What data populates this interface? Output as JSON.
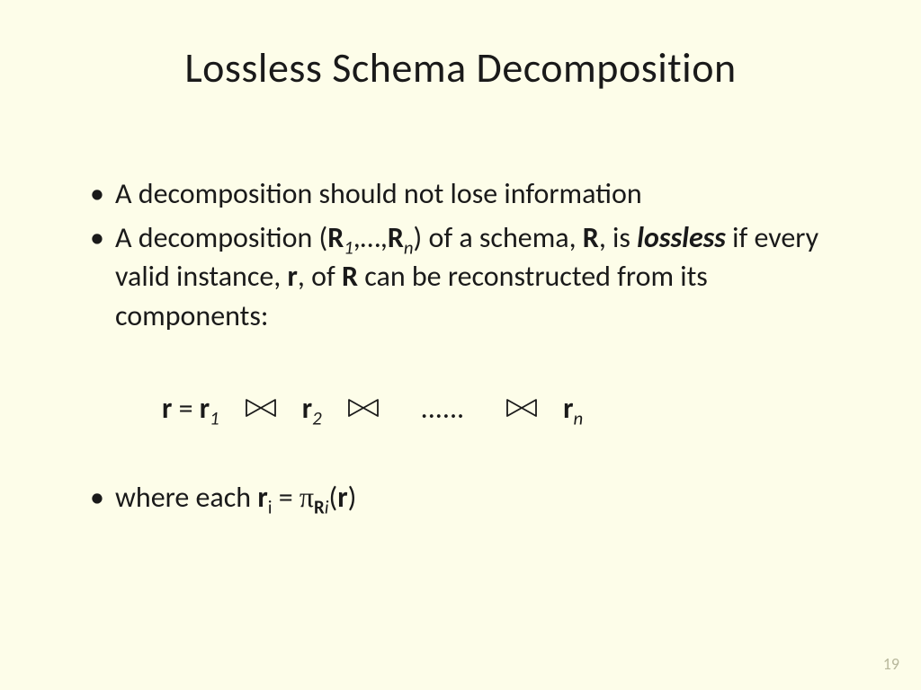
{
  "title": "Lossless Schema Decomposition",
  "bullets": {
    "b1": "A decomposition should not lose information",
    "b2": {
      "pre": "A decomposition (",
      "r1": "R",
      "sub1": "1",
      "mid1": ",…,",
      "rn": "R",
      "subn": "n",
      "mid2": ") of a schema, ",
      "rsch": "R",
      "mid3": ", is ",
      "lossless": "lossless",
      "mid4": " if every valid instance, ",
      "rinst": "r",
      "mid5": ", of ",
      "rsch2": "R",
      "tail": " can be reconstructed from its components:"
    },
    "b3": {
      "pre": "where each  ",
      "ri": "r",
      "subi": "i",
      "eq": " = ",
      "pi": "π",
      "Ri": "R",
      "subii": "i",
      "open": "(",
      "rarg": "r",
      "close": ")"
    }
  },
  "formula": {
    "req": "r",
    "eq": " = ",
    "r1": "r",
    "s1": "1",
    "r2": "r",
    "s2": "2",
    "dots": "......",
    "rn": "r",
    "sn": "n"
  },
  "page_number": "19"
}
